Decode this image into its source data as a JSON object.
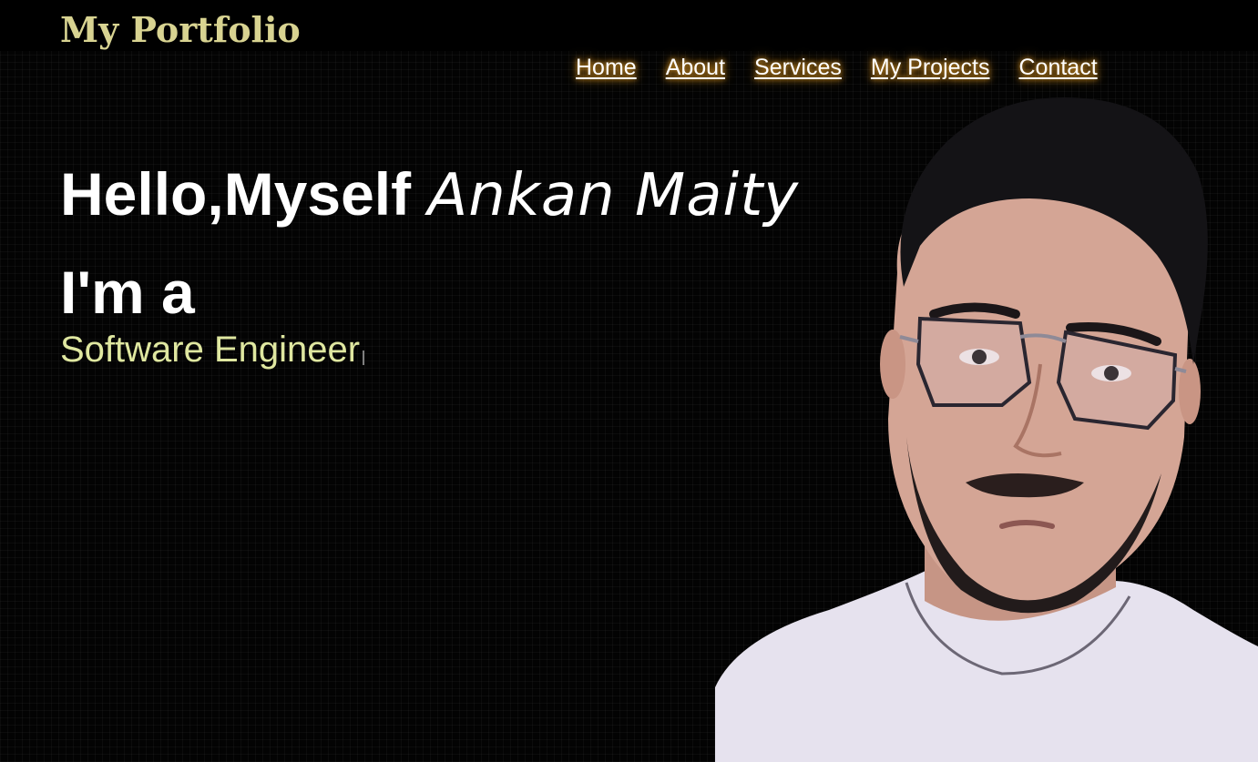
{
  "header": {
    "logo": "My Portfolio"
  },
  "nav": {
    "items": [
      {
        "label": "Home"
      },
      {
        "label": "About"
      },
      {
        "label": "Services"
      },
      {
        "label": "My Projects"
      },
      {
        "label": "Contact"
      }
    ]
  },
  "hero": {
    "greeting": "Hello,Myself ",
    "name": "Ankan Maity",
    "im_a": "I'm a",
    "role": "Software Engineer"
  },
  "colors": {
    "logo": "#d8d391",
    "role": "#dfe7a0",
    "nav_glow": "#f0a92d",
    "background": "#030303"
  },
  "icons": {
    "text_cursor": "typing-cursor-icon"
  }
}
